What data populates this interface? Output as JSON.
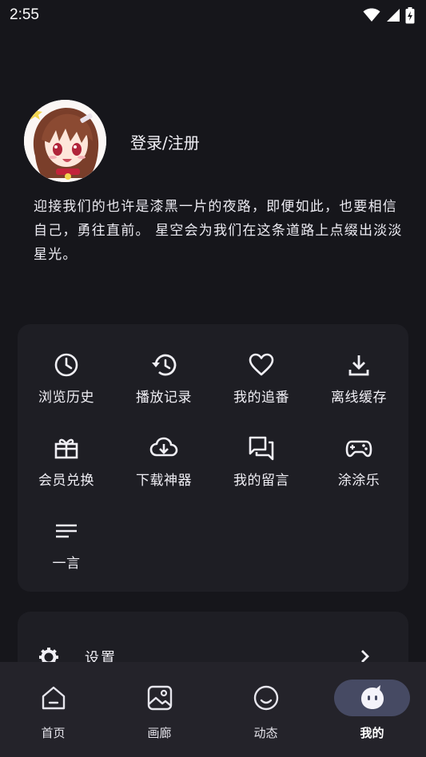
{
  "status_bar": {
    "time": "2:55",
    "icons": [
      "wifi-icon",
      "signal-icon",
      "battery-charging-icon"
    ]
  },
  "profile": {
    "avatar_icon": "anime-avatar",
    "login_label": "登录/注册",
    "motto": "迎接我们的也许是漆黑一片的夜路，即便如此，也要相信自己，勇往直前。 星空会为我们在这条道路上点缀出淡淡星光。"
  },
  "grid": [
    {
      "label": "浏览历史",
      "icon": "clock-icon"
    },
    {
      "label": "播放记录",
      "icon": "history-icon"
    },
    {
      "label": "我的追番",
      "icon": "heart-icon"
    },
    {
      "label": "离线缓存",
      "icon": "download-icon"
    },
    {
      "label": "会员兑换",
      "icon": "gift-icon"
    },
    {
      "label": "下载神器",
      "icon": "cloud-download-icon"
    },
    {
      "label": "我的留言",
      "icon": "forum-icon"
    },
    {
      "label": "涂涂乐",
      "icon": "gamepad-icon"
    },
    {
      "label": "一言",
      "icon": "lines-icon"
    }
  ],
  "settings": {
    "label": "设置",
    "icon": "gear-icon",
    "chevron": "chevron-right-icon"
  },
  "bottom_nav": {
    "items": [
      {
        "label": "首页",
        "icon": "home-icon",
        "active": false
      },
      {
        "label": "画廊",
        "icon": "gallery-icon",
        "active": false
      },
      {
        "label": "动态",
        "icon": "smiley-icon",
        "active": false
      },
      {
        "label": "我的",
        "icon": "mascot-icon",
        "active": true
      }
    ]
  },
  "colors": {
    "background": "#16161b",
    "card": "#1e1e24",
    "nav_background": "#24232a",
    "active_pill": "#464a63",
    "text": "#ecebf2"
  }
}
